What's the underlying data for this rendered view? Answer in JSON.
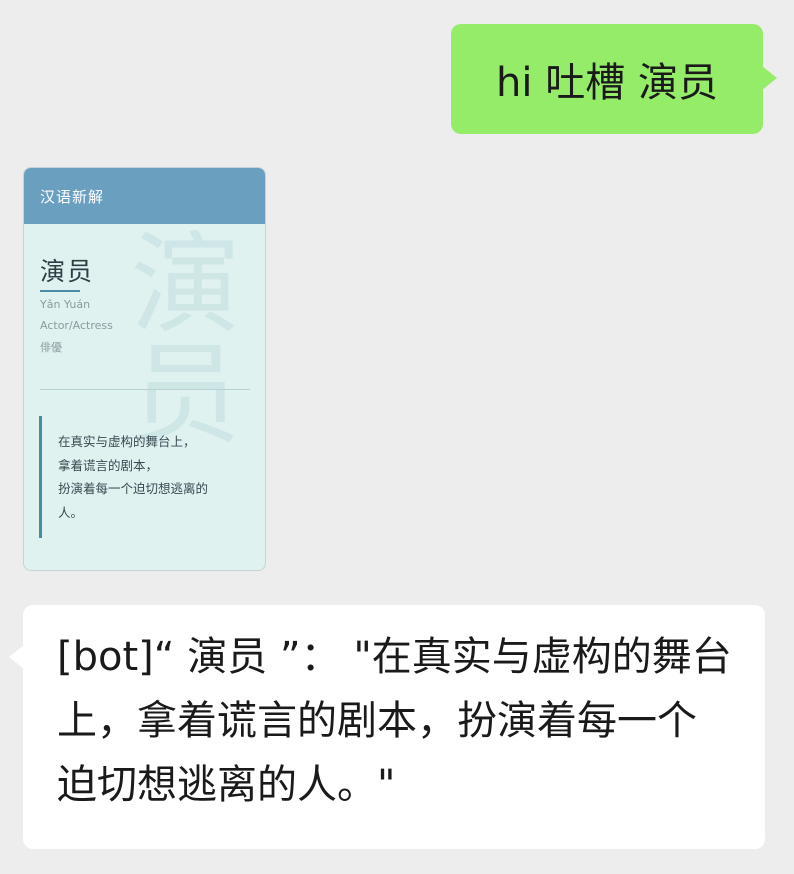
{
  "messages": {
    "outgoing": {
      "text": "hi 吐槽 演员"
    },
    "card": {
      "header_title": "汉语新解",
      "watermark": "演员",
      "word": "演员",
      "pinyin": "Yǎn Yuán",
      "english": "Actor/Actress",
      "japanese": "俳優",
      "quote_lines": [
        "在真实与虚构的舞台上，",
        "拿着谎言的剧本，",
        "扮演着每一个迫切想逃离的",
        "人。"
      ]
    },
    "incoming": {
      "text": "[bot]“ 演员 ”： \"在真实与虚构的舞台上，拿着谎言的剧本，扮演着每一个迫切想逃离的人。\""
    }
  },
  "colors": {
    "background": "#ededed",
    "outgoing_bubble": "#95ec69",
    "incoming_bubble": "#ffffff",
    "card_header": "#6a9fbf",
    "card_body": "#dff2ef",
    "card_accent": "#4b8aa4"
  }
}
